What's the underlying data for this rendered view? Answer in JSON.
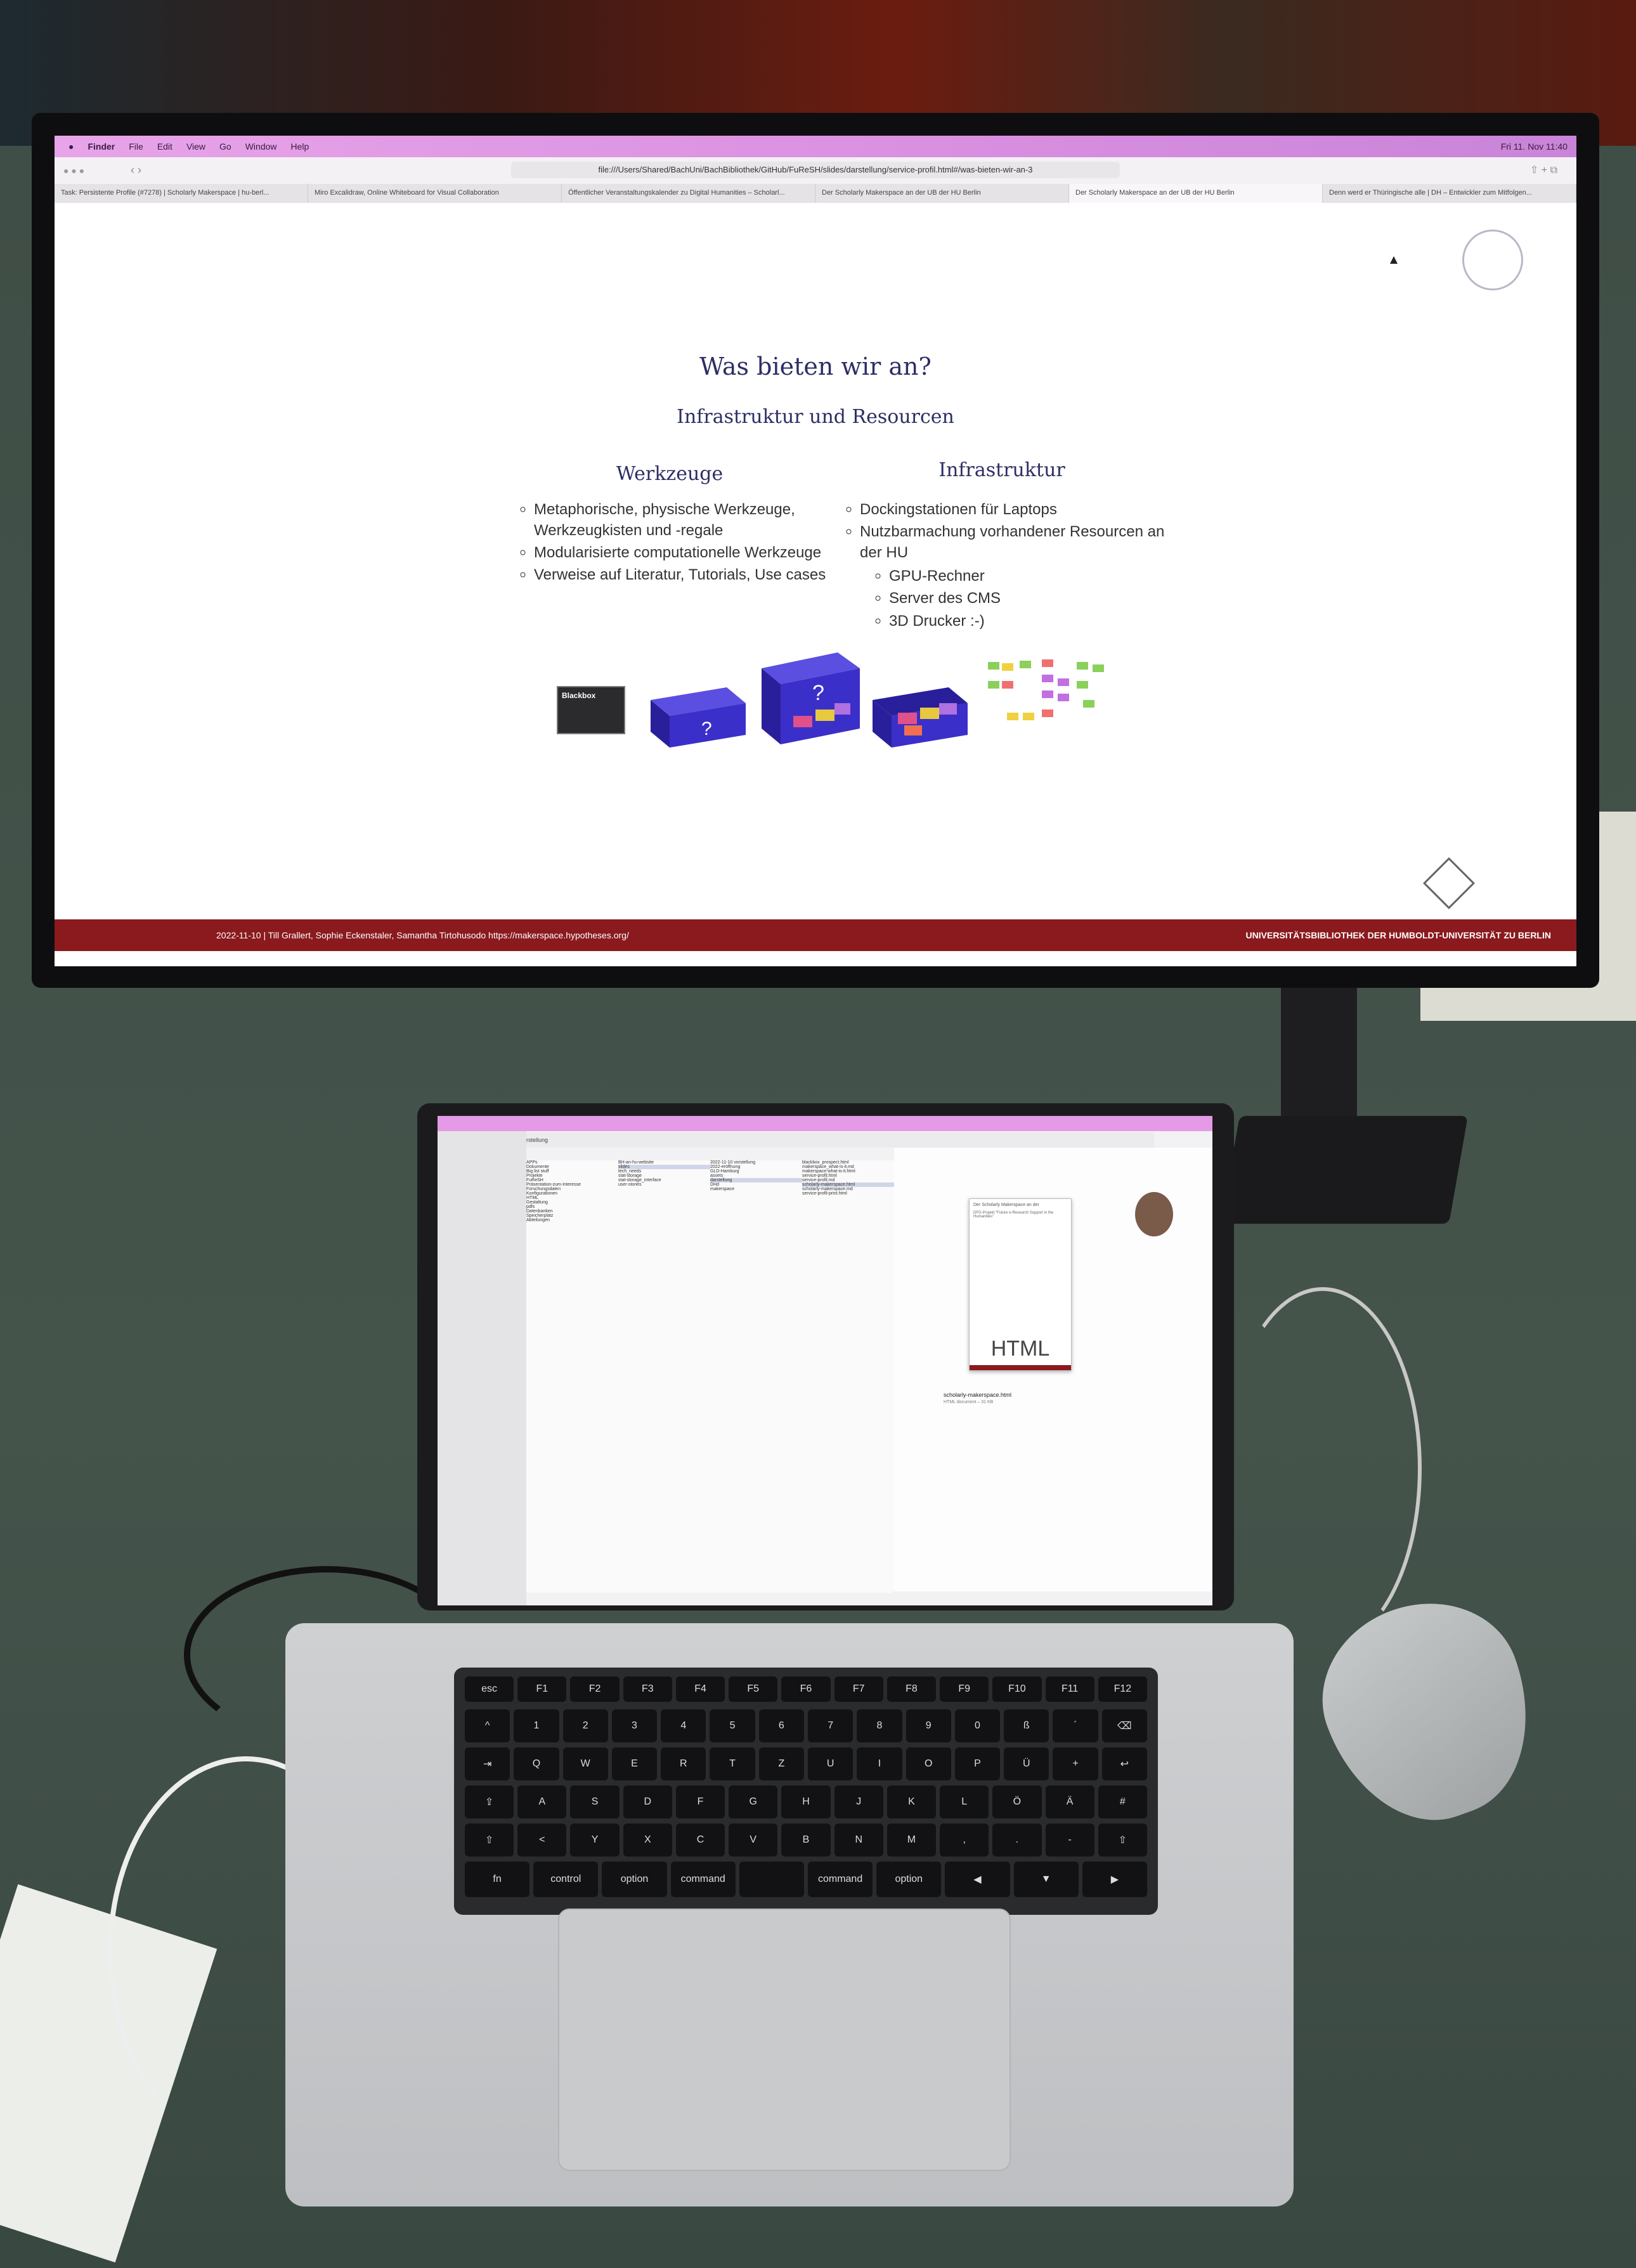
{
  "menubar": {
    "apple": "",
    "items": [
      "Finder",
      "File",
      "Edit",
      "View",
      "Go",
      "Window",
      "Help"
    ],
    "clock": "Fri 11. Nov 11:40"
  },
  "browser": {
    "url": "file:///Users/Shared/BachUni/BachBibliothek/GitHub/FuReSH/slides/darstellung/service-profil.html#/was-bieten-wir-an-3",
    "tabs": [
      "Task: Persistente Profile (#7278) | Scholarly Makerspace | hu-berl...",
      "Miro Excalidraw, Online Whiteboard for Visual Collaboration",
      "Öffentlicher Veranstaltungskalender zu Digital Humanities – Scholarl...",
      "Der Scholarly Makerspace an der UB der HU Berlin",
      "Der Scholarly Makerspace an der UB der HU Berlin",
      "Denn werd er Thüringische alle | DH – Entwickler zum Mitfolgen..."
    ]
  },
  "slide": {
    "title": "Was bieten wir an?",
    "subtitle": "Infrastruktur und Resourcen",
    "left": {
      "heading": "Werkzeuge",
      "bullets": [
        "Metaphorische, physische Werkzeuge, Werkzeugkisten und -regale",
        "Modularisierte computationelle Werkzeuge",
        "Verweise auf Literatur, Tutorials, Use cases"
      ]
    },
    "right": {
      "heading": "Infrastruktur",
      "bullets": [
        "Dockingstationen für Laptops",
        "Nutzbarmachung vorhandener Resourcen an der HU"
      ],
      "sub_bullets": [
        "GPU-Rechner",
        "Server des CMS",
        "3D Drucker :-)"
      ]
    },
    "blackbox_label": "Blackbox",
    "question_mark": "?",
    "footer_left": "2022-11-10  |  Till Grallert, Sophie Eckenstaler, Samantha Tirtohusodo   https://makerspace.hypotheses.org/",
    "footer_right": "UNIVERSITÄTSBIBLIOTHEK DER HUMBOLDT-UNIVERSITÄT ZU BERLIN"
  },
  "laptop": {
    "finder_title": "darstellung",
    "preview_label": "HTML",
    "preview_filename": "scholarly-makerspace.html",
    "preview_type": "HTML document – 31 KB",
    "doc_title_a": "Der Scholarly Makerspace an der",
    "doc_title_b": "DFG-Projekt \"Future e-Research Support in the Humanities\"",
    "col1": [
      "APPs",
      "Dokumente",
      "Big list stuff",
      "Projekte",
      "FuReSH",
      "Präsentation-zum-Interesse",
      "Forschungsdaten",
      "Konfigurationen",
      "HTML",
      "Gestaltung",
      "pdfs",
      "Datenbanken",
      "Speicherplatz",
      "Abteilungen"
    ],
    "col2": [
      "BH-an-hu-website",
      "slides",
      "tech_needs",
      "stat-storage",
      "stat-storage_interface",
      "user-stories"
    ],
    "col3": [
      "2022-11-10 vorstellung",
      "2022-eröffnung",
      "GLD-Hamburg",
      "assets",
      "darstellung",
      "DHd",
      "makerspace"
    ],
    "col4": [
      "blackbox_prospect.html",
      "makerspace_what-is-it.md",
      "makerspace-what-is-it.html",
      "service-profil.html",
      "service-profil.md",
      "scholarly-makerspace.html",
      "scholarly-makerspace.md",
      "service-profil-print.html"
    ]
  },
  "keyboard": {
    "row1": [
      "esc",
      "F1",
      "F2",
      "F3",
      "F4",
      "F5",
      "F6",
      "F7",
      "F8",
      "F9",
      "F10",
      "F11",
      "F12"
    ],
    "row2": [
      "^",
      "1",
      "2",
      "3",
      "4",
      "5",
      "6",
      "7",
      "8",
      "9",
      "0",
      "ß",
      "´",
      "⌫"
    ],
    "row3": [
      "⇥",
      "Q",
      "W",
      "E",
      "R",
      "T",
      "Z",
      "U",
      "I",
      "O",
      "P",
      "Ü",
      "+",
      "↩"
    ],
    "row4": [
      "⇪",
      "A",
      "S",
      "D",
      "F",
      "G",
      "H",
      "J",
      "K",
      "L",
      "Ö",
      "Ä",
      "#"
    ],
    "row5": [
      "⇧",
      "<",
      "Y",
      "X",
      "C",
      "V",
      "B",
      "N",
      "M",
      ",",
      ".",
      "-",
      "⇧"
    ],
    "row6": [
      "fn",
      "control",
      "option",
      "command",
      "",
      "command",
      "option",
      "◀",
      "▼",
      "▶"
    ]
  },
  "colors": {
    "menubar": "#d98fe0",
    "footer": "#8a1a1d",
    "slide_text": "#2d2e64",
    "box_blue": "#3b2fc9"
  }
}
